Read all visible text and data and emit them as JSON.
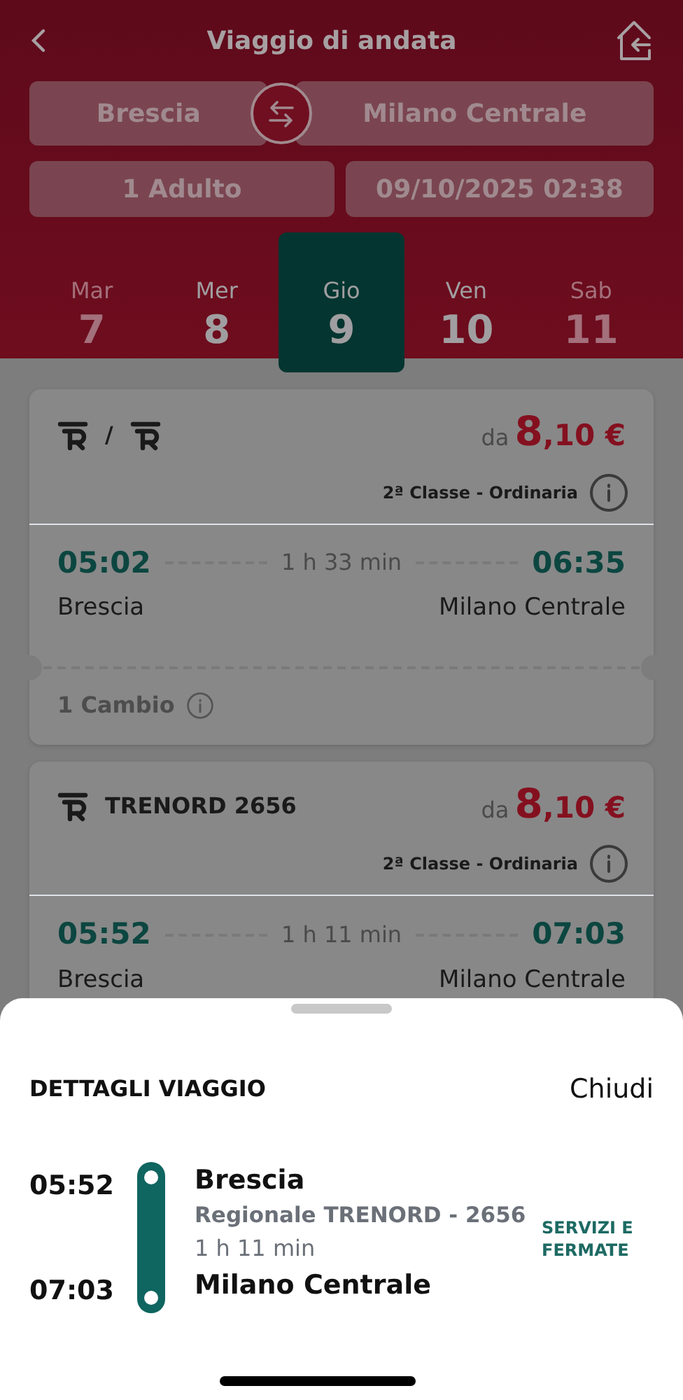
{
  "header": {
    "title": "Viaggio di andata",
    "from": "Brescia",
    "to": "Milano Centrale",
    "passengers": "1 Adulto",
    "datetime": "09/10/2025 02:38"
  },
  "days": [
    {
      "weekday": "Mar",
      "day": "7",
      "selected": false,
      "disabled": true
    },
    {
      "weekday": "Mer",
      "day": "8",
      "selected": false,
      "disabled": false
    },
    {
      "weekday": "Gio",
      "day": "9",
      "selected": true,
      "disabled": false
    },
    {
      "weekday": "Ven",
      "day": "10",
      "selected": false,
      "disabled": false
    },
    {
      "weekday": "Sab",
      "day": "11",
      "selected": false,
      "disabled": true
    }
  ],
  "solutions": [
    {
      "carrier": [
        {
          "kind": "logo"
        },
        {
          "kind": "text",
          "text": "/"
        },
        {
          "kind": "logo"
        }
      ],
      "price_prefix": "da",
      "price_units": "8",
      "price_cents": ",10 €",
      "fare_class": "2ª Classe - Ordinaria",
      "departure_time": "05:02",
      "duration": "1 h 33 min",
      "arrival_time": "06:35",
      "from": "Brescia",
      "to": "Milano Centrale",
      "changes": "1 Cambio"
    },
    {
      "carrier": [
        {
          "kind": "logo"
        },
        {
          "kind": "text",
          "text": "TRENORD 2656"
        }
      ],
      "price_prefix": "da",
      "price_units": "8",
      "price_cents": ",10 €",
      "fare_class": "2ª Classe - Ordinaria",
      "departure_time": "05:52",
      "duration": "1 h 11 min",
      "arrival_time": "07:03",
      "from": "Brescia",
      "to": "Milano Centrale"
    }
  ],
  "sheet": {
    "title": "DETTAGLI VIAGGIO",
    "close": "Chiudi",
    "departure_time": "05:52",
    "departure_station": "Brescia",
    "train": "Regionale TRENORD - 2656",
    "duration": "1 h 11 min",
    "arrival_time": "07:03",
    "arrival_station": "Milano Centrale",
    "link": "SERVIZI E FERMATE"
  }
}
